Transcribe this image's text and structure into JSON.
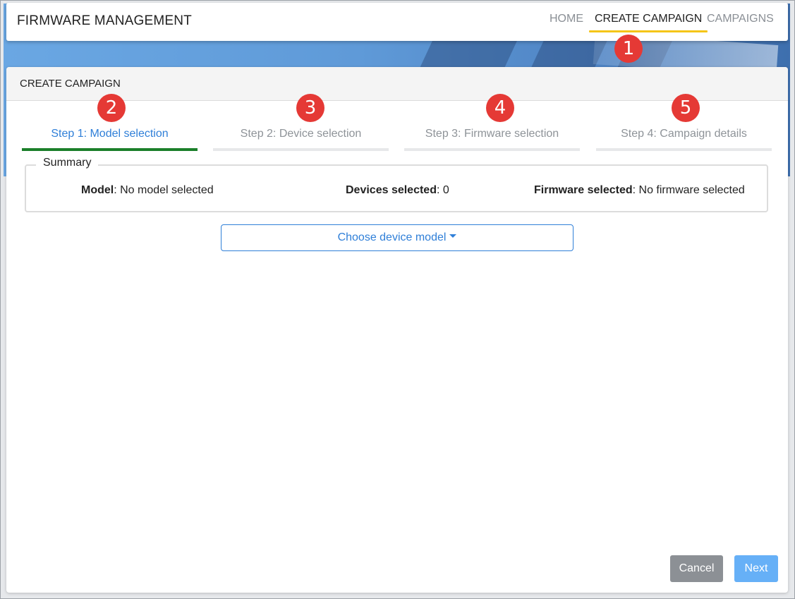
{
  "app": {
    "title": "FIRMWARE MANAGEMENT"
  },
  "nav": {
    "items": [
      {
        "label": "HOME",
        "active": false
      },
      {
        "label": "CREATE CAMPAIGN",
        "active": true
      },
      {
        "label": "CAMPAIGNS",
        "active": false
      }
    ]
  },
  "panel": {
    "title": "CREATE CAMPAIGN"
  },
  "steps": [
    {
      "label": "Step 1: Model selection",
      "active": true
    },
    {
      "label": "Step 2: Device selection",
      "active": false
    },
    {
      "label": "Step 3: Firmware selection",
      "active": false
    },
    {
      "label": "Step 4: Campaign details",
      "active": false
    }
  ],
  "summary": {
    "legend": "Summary",
    "model_label": "Model",
    "model_value": ": No model selected",
    "devices_label": "Devices selected",
    "devices_value": ": 0",
    "firmware_label": "Firmware selected",
    "firmware_value": ": No firmware selected"
  },
  "chooser": {
    "label": "Choose device model"
  },
  "buttons": {
    "cancel": "Cancel",
    "next": "Next"
  },
  "callouts": [
    "1",
    "2",
    "3",
    "4",
    "5"
  ],
  "colors": {
    "accent_blue": "#2f7fd8",
    "active_step_bar": "#1b7f2a",
    "active_nav_underline": "#f5c518",
    "callout_red": "#e53935",
    "cancel_gray": "#8c9095",
    "next_blue_disabled": "#66b0f7"
  }
}
